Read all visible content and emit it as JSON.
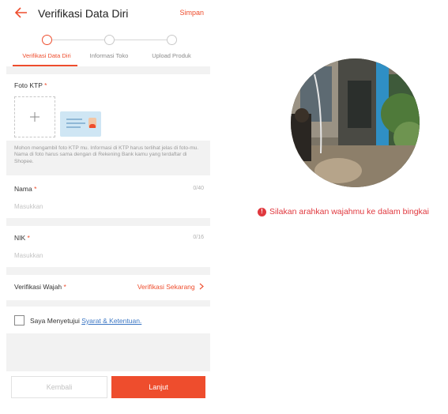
{
  "header": {
    "title": "Verifikasi Data Diri",
    "save_label": "Simpan"
  },
  "stepper": {
    "steps": [
      {
        "label": "Verifikasi Data Diri",
        "active": true
      },
      {
        "label": "Informasi Toko",
        "active": false
      },
      {
        "label": "Upload Produk",
        "active": false
      }
    ]
  },
  "ktp": {
    "label": "Foto KTP",
    "required_mark": "*",
    "hint": "Mohon mengambil foto KTP mu. Informasi di KTP harus terlihat jelas di foto-mu. Nama di foto harus sama dengan di Rekening Bank kamu yang terdaftar di Shopee."
  },
  "nama": {
    "label": "Nama",
    "required_mark": "*",
    "counter": "0/40",
    "placeholder": "Masukkan"
  },
  "nik": {
    "label": "NIK",
    "required_mark": "*",
    "counter": "0/16",
    "placeholder": "Masukkan"
  },
  "face_verification": {
    "label": "Verifikasi Wajah",
    "required_mark": "*",
    "action_label": "Verifikasi Sekarang",
    "action_icon": "chevron-right-icon"
  },
  "agreement": {
    "text": "Saya Menyetujui",
    "link_text": "Syarat & Ketentuan."
  },
  "footer": {
    "back_label": "Kembali",
    "next_label": "Lanjut"
  },
  "face_capture": {
    "message": "Silakan arahkan wajahmu ke dalam bingkai",
    "icon": "alert-icon"
  },
  "colors": {
    "accent": "#ee4d2d",
    "link": "#3b76c4",
    "error": "#e0383e"
  }
}
